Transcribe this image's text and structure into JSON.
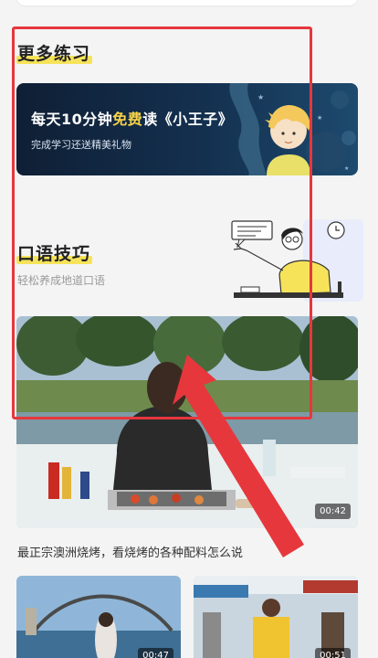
{
  "practice": {
    "title": "更多练习",
    "banner": {
      "line1_pre": "每天10分钟",
      "line1_free": "免费",
      "line1_post": "读《小王子》",
      "line2": "完成学习还送精美礼物"
    }
  },
  "tips": {
    "title": "口语技巧",
    "subtitle": "轻松养成地道口语"
  },
  "video": {
    "duration": "00:42",
    "title": "最正宗澳洲烧烤，看烧烤的各种配料怎么说"
  },
  "thumbs": [
    {
      "duration": "00:47"
    },
    {
      "duration": "00:51"
    }
  ],
  "colors": {
    "highlight": "#f7e35a",
    "annotation_red": "#e6373d",
    "banner_bg": "#14304f"
  }
}
